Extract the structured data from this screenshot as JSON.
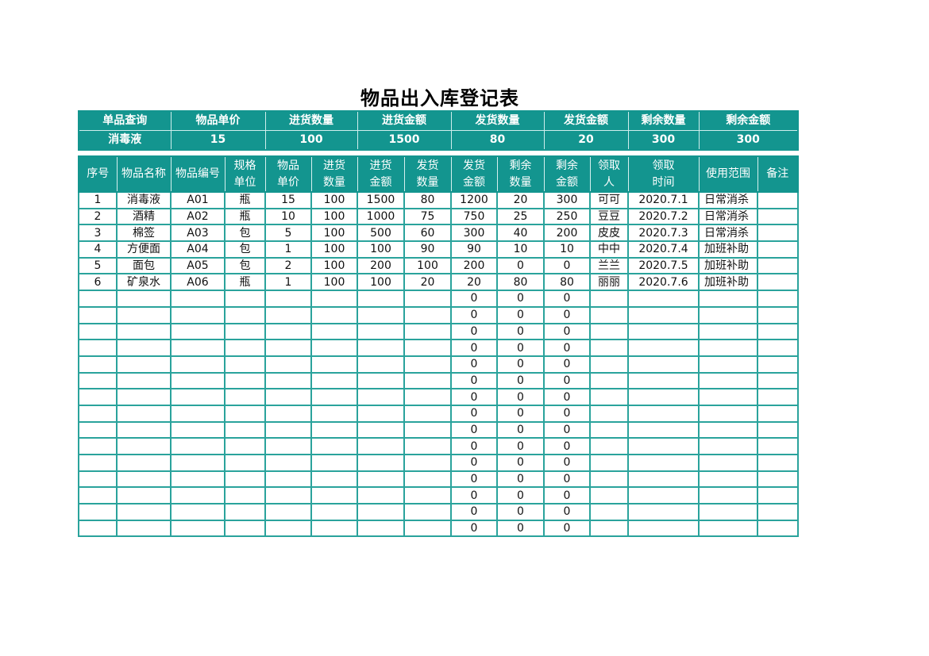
{
  "title": "物品出入库登记表",
  "colors": {
    "accent": "#13958f",
    "grid": "#2aa39c"
  },
  "query": {
    "headers": [
      "单品查询",
      "物品单价",
      "进货数量",
      "进货金额",
      "发货数量",
      "发货金额",
      "剩余数量",
      "剩余金额"
    ],
    "values": [
      "消毒液",
      "15",
      "100",
      "1500",
      "80",
      "20",
      "300",
      "300"
    ]
  },
  "table": {
    "headers": [
      [
        "序号"
      ],
      [
        "物品名称"
      ],
      [
        "物品编号"
      ],
      [
        "规格",
        "单位"
      ],
      [
        "物品",
        "单价"
      ],
      [
        "进货",
        "数量"
      ],
      [
        "进货",
        "金额"
      ],
      [
        "发货",
        "数量"
      ],
      [
        "发货",
        "金额"
      ],
      [
        "剩余",
        "数量"
      ],
      [
        "剩余",
        "金额"
      ],
      [
        "领取",
        "人"
      ],
      [
        "领取",
        "时间"
      ],
      [
        "使用范围"
      ],
      [
        "备注"
      ]
    ],
    "rows": [
      [
        "1",
        "消毒液",
        "A01",
        "瓶",
        "15",
        "100",
        "1500",
        "80",
        "1200",
        "20",
        "300",
        "可可",
        "2020.7.1",
        "日常消杀",
        ""
      ],
      [
        "2",
        "酒精",
        "A02",
        "瓶",
        "10",
        "100",
        "1000",
        "75",
        "750",
        "25",
        "250",
        "豆豆",
        "2020.7.2",
        "日常消杀",
        ""
      ],
      [
        "3",
        "棉签",
        "A03",
        "包",
        "5",
        "100",
        "500",
        "60",
        "300",
        "40",
        "200",
        "皮皮",
        "2020.7.3",
        "日常消杀",
        ""
      ],
      [
        "4",
        "方便面",
        "A04",
        "包",
        "1",
        "100",
        "100",
        "90",
        "90",
        "10",
        "10",
        "中中",
        "2020.7.4",
        "加班补助",
        ""
      ],
      [
        "5",
        "面包",
        "A05",
        "包",
        "2",
        "100",
        "200",
        "100",
        "200",
        "0",
        "0",
        "兰兰",
        "2020.7.5",
        "加班补助",
        ""
      ],
      [
        "6",
        "矿泉水",
        "A06",
        "瓶",
        "1",
        "100",
        "100",
        "20",
        "20",
        "80",
        "80",
        "丽丽",
        "2020.7.6",
        "加班补助",
        ""
      ],
      [
        "",
        "",
        "",
        "",
        "",
        "",
        "",
        "",
        "0",
        "0",
        "0",
        "",
        "",
        "",
        ""
      ],
      [
        "",
        "",
        "",
        "",
        "",
        "",
        "",
        "",
        "0",
        "0",
        "0",
        "",
        "",
        "",
        ""
      ],
      [
        "",
        "",
        "",
        "",
        "",
        "",
        "",
        "",
        "0",
        "0",
        "0",
        "",
        "",
        "",
        ""
      ],
      [
        "",
        "",
        "",
        "",
        "",
        "",
        "",
        "",
        "0",
        "0",
        "0",
        "",
        "",
        "",
        ""
      ],
      [
        "",
        "",
        "",
        "",
        "",
        "",
        "",
        "",
        "0",
        "0",
        "0",
        "",
        "",
        "",
        ""
      ],
      [
        "",
        "",
        "",
        "",
        "",
        "",
        "",
        "",
        "0",
        "0",
        "0",
        "",
        "",
        "",
        ""
      ],
      [
        "",
        "",
        "",
        "",
        "",
        "",
        "",
        "",
        "0",
        "0",
        "0",
        "",
        "",
        "",
        ""
      ],
      [
        "",
        "",
        "",
        "",
        "",
        "",
        "",
        "",
        "0",
        "0",
        "0",
        "",
        "",
        "",
        ""
      ],
      [
        "",
        "",
        "",
        "",
        "",
        "",
        "",
        "",
        "0",
        "0",
        "0",
        "",
        "",
        "",
        ""
      ],
      [
        "",
        "",
        "",
        "",
        "",
        "",
        "",
        "",
        "0",
        "0",
        "0",
        "",
        "",
        "",
        ""
      ],
      [
        "",
        "",
        "",
        "",
        "",
        "",
        "",
        "",
        "0",
        "0",
        "0",
        "",
        "",
        "",
        ""
      ],
      [
        "",
        "",
        "",
        "",
        "",
        "",
        "",
        "",
        "0",
        "0",
        "0",
        "",
        "",
        "",
        ""
      ],
      [
        "",
        "",
        "",
        "",
        "",
        "",
        "",
        "",
        "0",
        "0",
        "0",
        "",
        "",
        "",
        ""
      ],
      [
        "",
        "",
        "",
        "",
        "",
        "",
        "",
        "",
        "0",
        "0",
        "0",
        "",
        "",
        "",
        ""
      ],
      [
        "",
        "",
        "",
        "",
        "",
        "",
        "",
        "",
        "0",
        "0",
        "0",
        "",
        "",
        "",
        ""
      ]
    ]
  }
}
